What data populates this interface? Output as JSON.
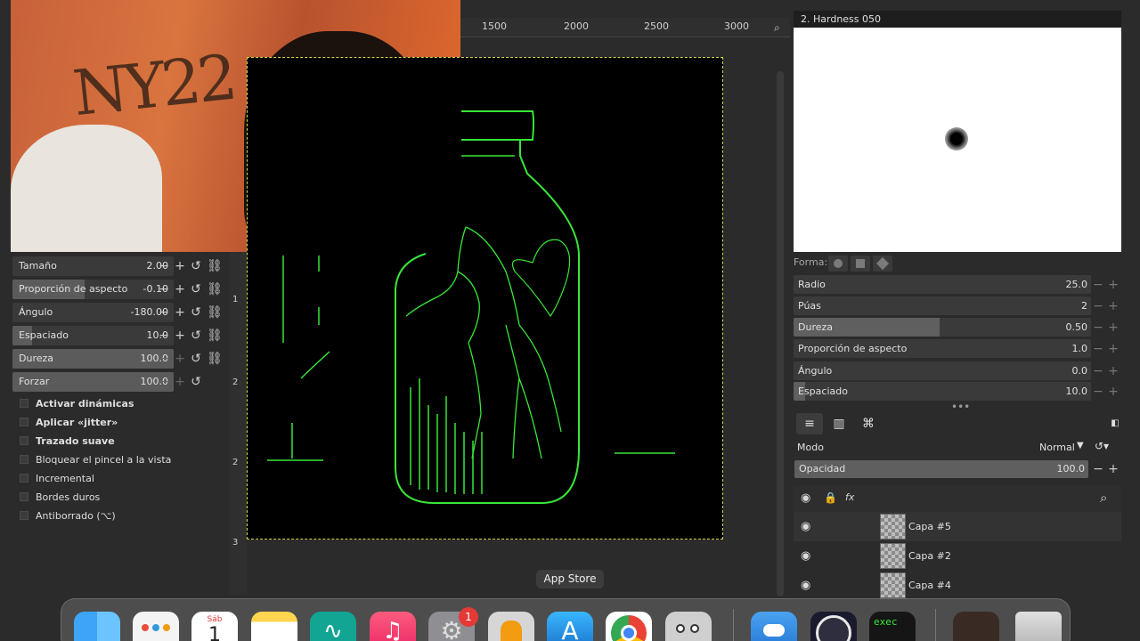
{
  "ruler_top": {
    "ticks": [
      "1500",
      "2000",
      "2500",
      "3000"
    ]
  },
  "ruler_left": {
    "ticks": [
      "1",
      "2",
      "2",
      "3"
    ]
  },
  "tool_options": {
    "sliders": [
      {
        "label": "Tamaño",
        "value": "2.00"
      },
      {
        "label": "Proporción de aspecto",
        "value": "-0.10"
      },
      {
        "label": "Ángulo",
        "value": "-180.00"
      },
      {
        "label": "Espaciado",
        "value": "10.0"
      },
      {
        "label": "Dureza",
        "value": "100.0"
      },
      {
        "label": "Forzar",
        "value": "100.0"
      }
    ],
    "checks": [
      {
        "label": "Activar dinámicas",
        "bold": true
      },
      {
        "label": "Aplicar «jitter»",
        "bold": true
      },
      {
        "label": "Trazado suave",
        "bold": true
      },
      {
        "label": "Bloquear el pincel a la vista",
        "bold": false
      },
      {
        "label": "Incremental",
        "bold": false
      },
      {
        "label": "Bordes duros",
        "bold": false
      },
      {
        "label": "Antiborrado (⌥)",
        "bold": false
      }
    ]
  },
  "brush_editor": {
    "title": "2. Hardness 050",
    "shape_label": "Forma:",
    "params": [
      {
        "label": "Radio",
        "value": "25.0",
        "fill": 0.0
      },
      {
        "label": "Púas",
        "value": "2",
        "fill": 0.0
      },
      {
        "label": "Dureza",
        "value": "0.50",
        "fill": 0.49
      },
      {
        "label": "Proporción de aspecto",
        "value": "1.0",
        "fill": 0.0
      },
      {
        "label": "Ángulo",
        "value": "0.0",
        "fill": 0.0
      },
      {
        "label": "Espaciado",
        "value": "10.0",
        "fill": 0.04
      }
    ]
  },
  "layers": {
    "mode_label": "Modo",
    "mode_value": "Normal",
    "opacity_label": "Opacidad",
    "opacity_value": "100.0",
    "items": [
      {
        "name": "Capa #5"
      },
      {
        "name": "Capa #2"
      },
      {
        "name": "Capa #4"
      }
    ]
  },
  "tooltip": "App Store",
  "dock": {
    "calendar_day": "Sáb",
    "calendar_date": "1",
    "settings_badge": "1",
    "terminal_label": "exec"
  },
  "colors": {
    "canvas_stroke": "#39e639",
    "accent_blue": "#1e88e5"
  }
}
